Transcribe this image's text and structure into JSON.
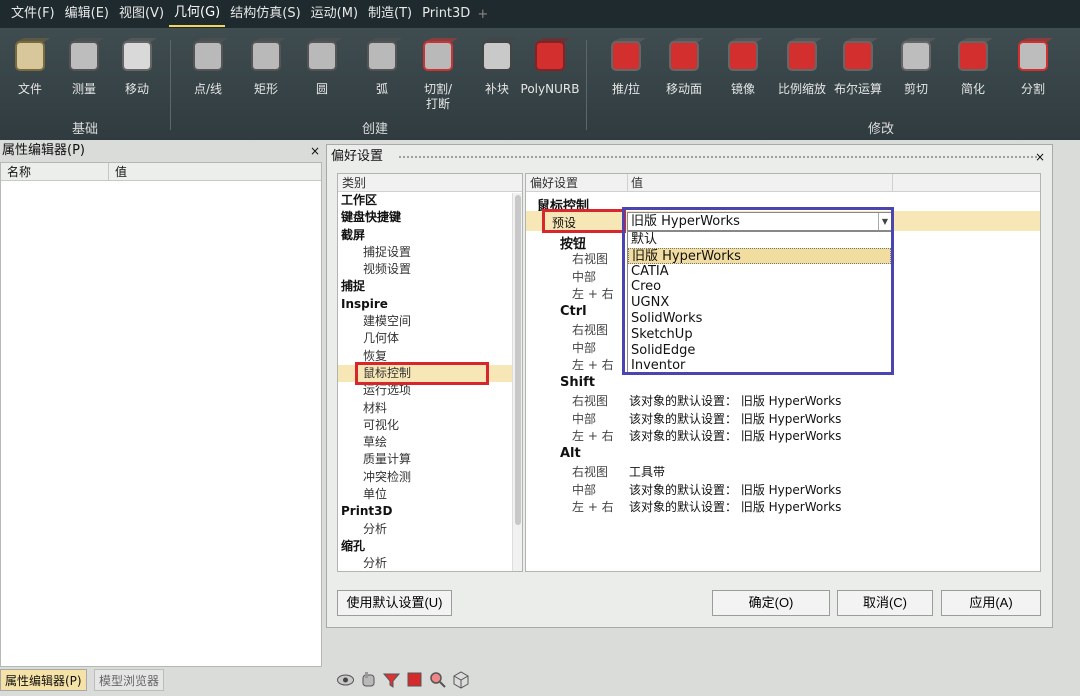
{
  "menu": [
    "文件(F)",
    "编辑(E)",
    "视图(V)",
    "几何(G)",
    "结构仿真(S)",
    "运动(M)",
    "制造(T)",
    "Print3D"
  ],
  "menu_active_index": 3,
  "ribbon": {
    "tools": [
      {
        "label": "文件",
        "icon": "file-icon"
      },
      {
        "label": "测量",
        "icon": "measure-icon"
      },
      {
        "label": "移动",
        "icon": "move-icon"
      },
      {
        "label": "点/线",
        "icon": "point-line-icon"
      },
      {
        "label": "矩形",
        "icon": "rectangle-icon"
      },
      {
        "label": "圆",
        "icon": "circle-icon"
      },
      {
        "label": "弧",
        "icon": "arc-icon"
      },
      {
        "label": "切割/\n打断",
        "icon": "cut-break-icon"
      },
      {
        "label": "补块",
        "icon": "patch-icon"
      },
      {
        "label": "PolyNURB",
        "icon": "polynurb-icon"
      },
      {
        "label": "推/拉",
        "icon": "push-pull-icon"
      },
      {
        "label": "移动面",
        "icon": "move-face-icon"
      },
      {
        "label": "镜像",
        "icon": "mirror-icon"
      },
      {
        "label": "比例缩放",
        "icon": "scale-icon"
      },
      {
        "label": "布尔运算",
        "icon": "boolean-icon"
      },
      {
        "label": "剪切",
        "icon": "trim-icon"
      },
      {
        "label": "简化",
        "icon": "simplify-icon"
      },
      {
        "label": "分割",
        "icon": "split-icon"
      }
    ],
    "groups": [
      "基础",
      "创建",
      "修改"
    ]
  },
  "property_editor": {
    "title": "属性编辑器(P)",
    "col_name": "名称",
    "col_value": "值"
  },
  "bottom_tabs": [
    "属性编辑器(P)",
    "模型浏览器"
  ],
  "dialog": {
    "title": "偏好设置",
    "category_header": "类别",
    "categories": [
      {
        "text": "工作区",
        "level": 0
      },
      {
        "text": "键盘快捷键",
        "level": 0
      },
      {
        "text": "截屏",
        "level": 0
      },
      {
        "text": "捕捉设置",
        "level": 1
      },
      {
        "text": "视频设置",
        "level": 1
      },
      {
        "text": "捕捉",
        "level": 0
      },
      {
        "text": "Inspire",
        "level": 0
      },
      {
        "text": "建模空间",
        "level": 1
      },
      {
        "text": "几何体",
        "level": 1
      },
      {
        "text": "恢复",
        "level": 1
      },
      {
        "text": "鼠标控制",
        "level": 1,
        "selected": true
      },
      {
        "text": "运行选项",
        "level": 1
      },
      {
        "text": "材料",
        "level": 1
      },
      {
        "text": "可视化",
        "level": 1
      },
      {
        "text": "草绘",
        "level": 1
      },
      {
        "text": "质量计算",
        "level": 1
      },
      {
        "text": "冲突检测",
        "level": 1
      },
      {
        "text": "单位",
        "level": 1
      },
      {
        "text": "Print3D",
        "level": 0
      },
      {
        "text": "分析",
        "level": 1
      },
      {
        "text": "缩孔",
        "level": 0
      },
      {
        "text": "分析",
        "level": 1
      }
    ],
    "settings_header": "偏好设置",
    "value_header": "值",
    "section_title": "鼠标控制",
    "preset_label": "预设",
    "preset_value": "旧版 HyperWorks",
    "options": [
      "默认",
      "旧版 HyperWorks",
      "CATIA",
      "Creo",
      "UGNX",
      "SolidWorks",
      "SketchUp",
      "SolidEdge",
      "Inventor"
    ],
    "selected_option_index": 1,
    "groups": [
      {
        "title": "按钮",
        "rows": [
          {
            "key": "右视图",
            "value": ""
          },
          {
            "key": "中部",
            "value": ""
          },
          {
            "key": "左 + 右",
            "value": ""
          }
        ]
      },
      {
        "title": "Ctrl",
        "rows": [
          {
            "key": "右视图",
            "value": ""
          },
          {
            "key": "中部",
            "value": ""
          },
          {
            "key": "左 + 右",
            "value": ""
          }
        ]
      },
      {
        "title": "Shift",
        "rows": [
          {
            "key": "右视图",
            "value": "该对象的默认设置：  旧版 HyperWorks"
          },
          {
            "key": "中部",
            "value": "该对象的默认设置：  旧版 HyperWorks"
          },
          {
            "key": "左 + 右",
            "value": "该对象的默认设置：  旧版 HyperWorks"
          }
        ]
      },
      {
        "title": "Alt",
        "rows": [
          {
            "key": "右视图",
            "value": "工具带"
          },
          {
            "key": "中部",
            "value": "该对象的默认设置：  旧版 HyperWorks"
          },
          {
            "key": "左 + 右",
            "value": "该对象的默认设置：  旧版 HyperWorks"
          }
        ]
      }
    ],
    "buttons": {
      "defaults": "使用默认设置(U)",
      "ok": "确定(O)",
      "cancel": "取消(C)",
      "apply": "应用(A)"
    }
  }
}
